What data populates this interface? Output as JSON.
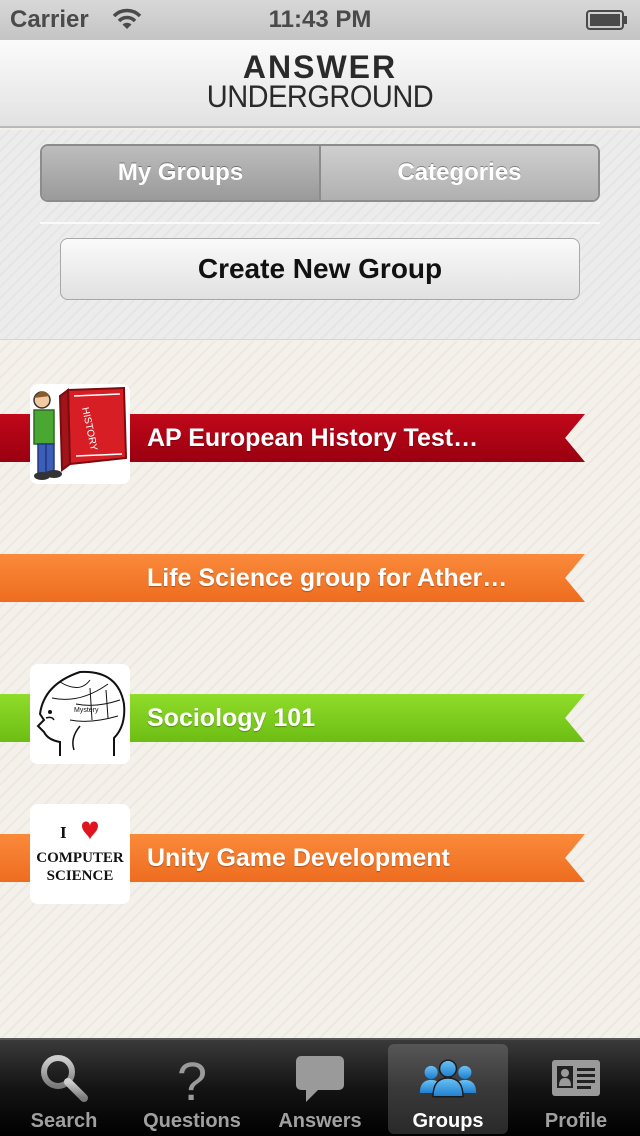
{
  "status_bar": {
    "carrier": "Carrier",
    "time": "11:43 PM"
  },
  "header": {
    "logo_line1": "ANSWER",
    "logo_line2": "UNDERGROUND"
  },
  "segmented": {
    "my_groups": "My Groups",
    "categories": "Categories",
    "selected": "My Groups"
  },
  "create_button": "Create New Group",
  "groups": [
    {
      "title": "AP European History Test…",
      "color": "#a3000f",
      "thumbnail": "history-book-icon"
    },
    {
      "title": "Life Science group for Ather…",
      "color": "#f47a2c",
      "thumbnail": "none"
    },
    {
      "title": "Sociology 101",
      "color": "#7ccb1e",
      "thumbnail": "phrenology-head-icon"
    },
    {
      "title": "Unity Game Development",
      "color": "#f47a2c",
      "thumbnail": "i-love-computer-science-icon"
    }
  ],
  "computer_science_thumb": {
    "line1": "I",
    "line2": "COMPUTER",
    "line3": "SCIENCE"
  },
  "tab_bar": {
    "tabs": [
      {
        "label": "Search",
        "icon": "search-icon"
      },
      {
        "label": "Questions",
        "icon": "question-icon"
      },
      {
        "label": "Answers",
        "icon": "speech-bubble-icon"
      },
      {
        "label": "Groups",
        "icon": "people-icon"
      },
      {
        "label": "Profile",
        "icon": "id-card-icon"
      }
    ],
    "selected": "Groups",
    "selected_color": "#2f9ae0"
  }
}
